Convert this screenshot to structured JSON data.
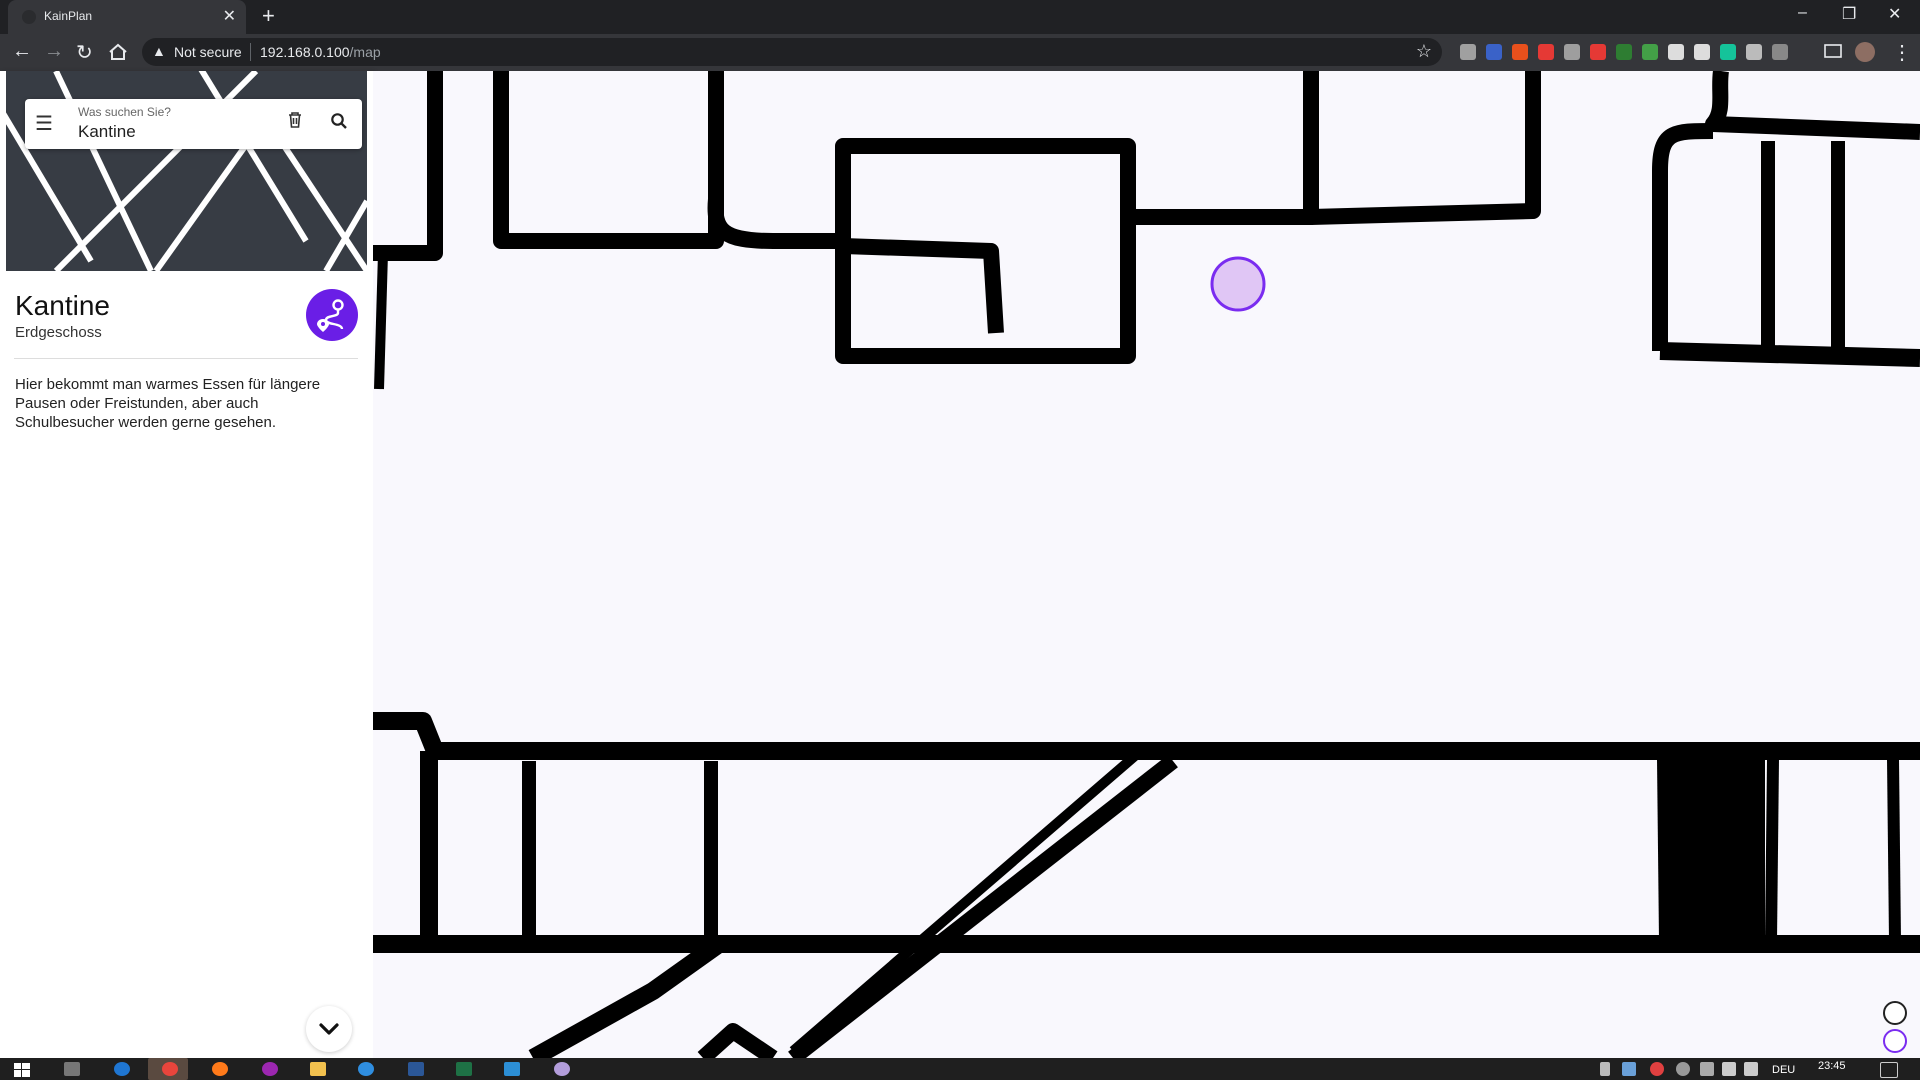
{
  "browser": {
    "tab_title": "KainPlan",
    "tab_close": "✕",
    "new_tab": "+",
    "window_controls": [
      "–",
      "❐",
      "✕"
    ],
    "security_label": "Not secure",
    "url_host": "192.168.0.100",
    "url_path": "/map",
    "extension_colors": [
      "#a0a0a0",
      "#3a62c8",
      "#e8501c",
      "#e53935",
      "#9e9e9e",
      "#e53935",
      "#2e7d32",
      "#43a047",
      "#dddddd",
      "#dddddd",
      "#15c39a",
      "#bbbbbb",
      "#888888"
    ]
  },
  "sidebar": {
    "search": {
      "label": "Was suchen Sie?",
      "value": "Kantine",
      "menu_icon": "menu-icon",
      "clear_icon": "trash-icon",
      "search_icon": "search-icon"
    },
    "place": {
      "title": "Kantine",
      "floor": "Erdgeschoss",
      "description": "Hier bekommt man warmes Essen für längere Pausen oder Freistunden, aber auch Schulbesucher werden gerne gesehen.",
      "route_icon": "route-icon",
      "accent_color": "#6a1ee6"
    },
    "collapse_icon": "chevron-down-icon"
  },
  "map": {
    "background": "#f9f8fd",
    "wall_color": "#000000",
    "marker_fill": "#e0c6f5",
    "marker_stroke": "#7a2cf0"
  },
  "taskbar": {
    "language": "DEU",
    "time": "23:45"
  }
}
